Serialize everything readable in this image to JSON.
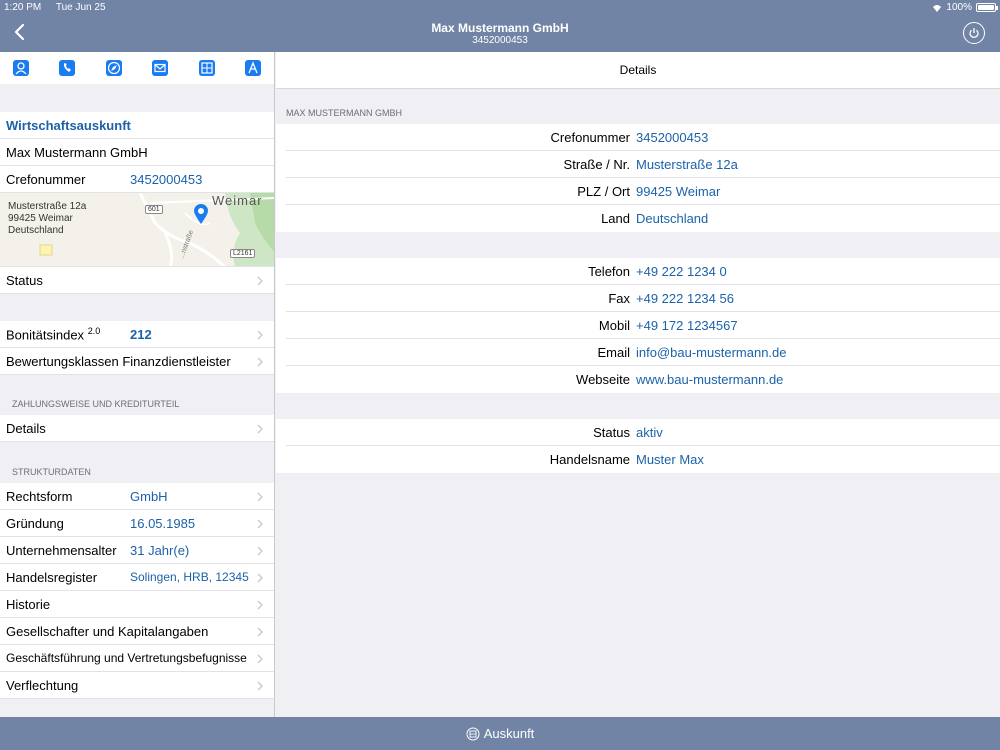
{
  "status_bar": {
    "time": "1:20 PM",
    "date": "Tue Jun 25",
    "battery": "100%"
  },
  "nav": {
    "title": "Max Mustermann GmbH",
    "subtitle": "3452000453"
  },
  "toolbar": {
    "icons": [
      "contact-icon",
      "phone-icon",
      "compass-icon",
      "mail-icon",
      "calculator-icon",
      "pdf-icon"
    ]
  },
  "left": {
    "wirtschaftsauskunft": "Wirtschaftsauskunft",
    "company_name": "Max Mustermann GmbH",
    "crefo_label": "Crefonummer",
    "crefo_value": "3452000453",
    "map": {
      "address_line1": "Musterstraße 12a",
      "address_line2": "99425 Weimar",
      "address_line3": "Deutschland",
      "city_label": "Weimar",
      "road_601": "601",
      "road_l2161": "L2161",
      "street_label": "...nstraße"
    },
    "status_label": "Status",
    "bonitaet_label": "Bonitätsindex",
    "bonitaet_sup": "2.0",
    "bonitaet_value": "212",
    "bewertung_label": "Bewertungsklassen Finanzdienstleister",
    "section_zahlung": "ZAHLUNGSWEISE UND KREDITURTEIL",
    "details_label": "Details",
    "section_struktur": "STRUKTURDATEN",
    "struktur": [
      {
        "label": "Rechtsform",
        "value": "GmbH"
      },
      {
        "label": "Gründung",
        "value": "16.05.1985"
      },
      {
        "label": "Unternehmensalter",
        "value": "31 Jahr(e)"
      },
      {
        "label": "Handelsregister",
        "value": "Solingen, HRB, 12345"
      },
      {
        "label": "Historie",
        "value": ""
      },
      {
        "label": "Gesellschafter und Kapitalangaben",
        "value": ""
      },
      {
        "label": "Geschäftsführung und Vertretungsbefugnisse",
        "value": ""
      },
      {
        "label": "Verflechtung",
        "value": ""
      }
    ]
  },
  "right": {
    "header": "Details",
    "section_company": "MAX MUSTERMANN GMBH",
    "address": [
      {
        "label": "Crefonummer",
        "value": "3452000453"
      },
      {
        "label": "Straße / Nr.",
        "value": "Musterstraße 12a"
      },
      {
        "label": "PLZ / Ort",
        "value": "99425 Weimar"
      },
      {
        "label": "Land",
        "value": "Deutschland"
      }
    ],
    "contact": [
      {
        "label": "Telefon",
        "value": "+49 222 1234 0"
      },
      {
        "label": "Fax",
        "value": "+49 222 1234 56"
      },
      {
        "label": "Mobil",
        "value": "+49 172 1234567"
      },
      {
        "label": "Email",
        "value": "info@bau-mustermann.de"
      },
      {
        "label": "Webseite",
        "value": "www.bau-mustermann.de"
      }
    ],
    "extra": [
      {
        "label": "Status",
        "value": "aktiv"
      },
      {
        "label": "Handelsname",
        "value": "Muster Max"
      }
    ]
  },
  "bottom": {
    "label": "Auskunft"
  },
  "colors": {
    "navbar": "#7184a6",
    "link": "#1c62a9",
    "icon": "#1a7cf0"
  }
}
